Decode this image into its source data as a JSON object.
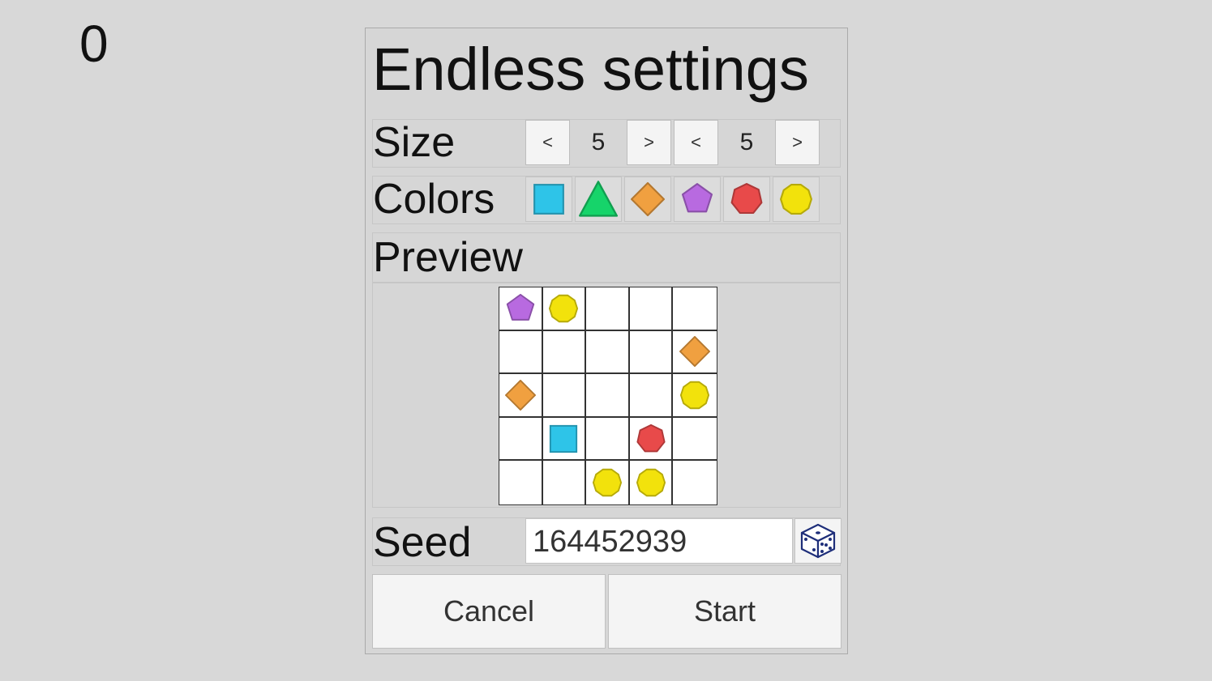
{
  "score": "0",
  "dialog": {
    "title": "Endless settings",
    "size": {
      "label": "Size",
      "dec_label": "<",
      "inc_label": ">",
      "width": "5",
      "height": "5"
    },
    "colors": {
      "label": "Colors",
      "items": [
        {
          "shape": "square",
          "color": "#2ec4e8"
        },
        {
          "shape": "triangle",
          "color": "#16d46a"
        },
        {
          "shape": "diamond",
          "color": "#f0a040"
        },
        {
          "shape": "pentagon",
          "color": "#b86ae0"
        },
        {
          "shape": "heptagon",
          "color": "#e84a4a"
        },
        {
          "shape": "circle",
          "color": "#f2e20c"
        }
      ]
    },
    "preview": {
      "label": "Preview",
      "grid": [
        [
          "pentagon",
          "circle",
          "",
          "",
          ""
        ],
        [
          "",
          "",
          "",
          "",
          "diamond"
        ],
        [
          "diamond",
          "",
          "",
          "",
          "circle"
        ],
        [
          "",
          "square",
          "",
          "heptagon",
          ""
        ],
        [
          "",
          "",
          "circle",
          "circle",
          ""
        ]
      ]
    },
    "seed": {
      "label": "Seed",
      "value": "164452939",
      "random_icon": "dice-icon"
    },
    "cancel_label": "Cancel",
    "start_label": "Start"
  }
}
